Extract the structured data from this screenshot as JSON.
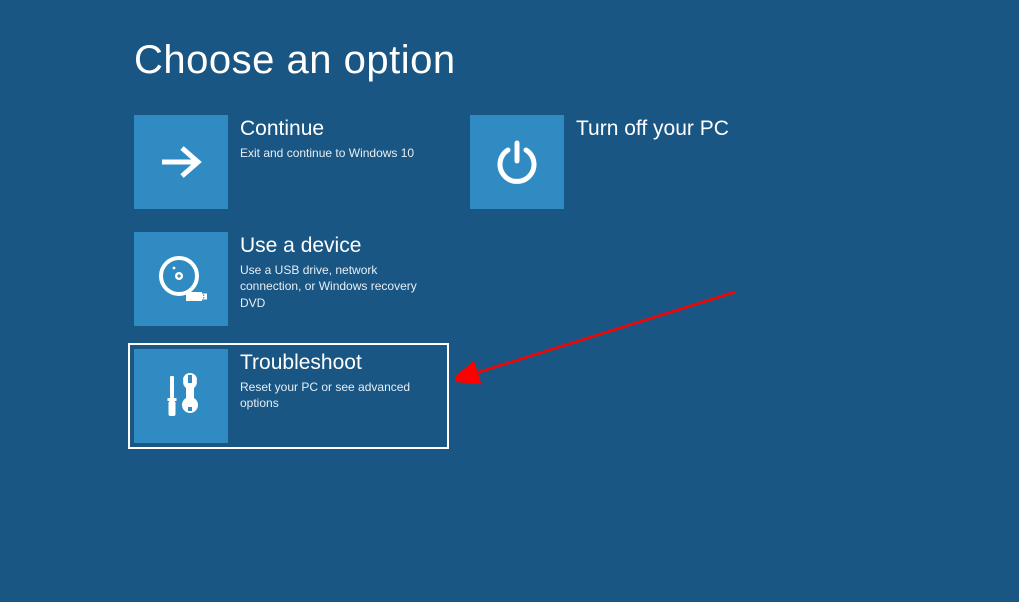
{
  "page": {
    "title": "Choose an option"
  },
  "tiles": {
    "continue": {
      "title": "Continue",
      "desc": "Exit and continue to Windows 10"
    },
    "turnoff": {
      "title": "Turn off your PC",
      "desc": ""
    },
    "device": {
      "title": "Use a device",
      "desc": "Use a USB drive, network connection, or Windows recovery DVD"
    },
    "troubleshoot": {
      "title": "Troubleshoot",
      "desc": "Reset your PC or see advanced options"
    }
  },
  "colors": {
    "background": "#195683",
    "tile_icon_bg": "#2f8bc1",
    "annotation_arrow": "#ff0000"
  }
}
